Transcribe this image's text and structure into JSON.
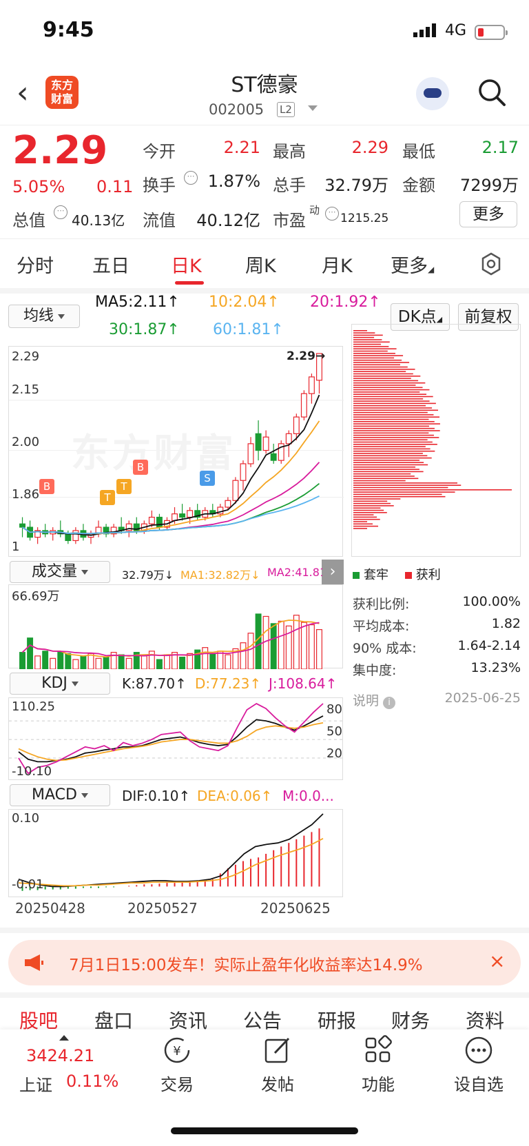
{
  "status_bar": {
    "time": "9:45",
    "network": "4G"
  },
  "header": {
    "name": "ST德豪",
    "code": "002005",
    "level_badge": "L2",
    "logo_line1": "东方",
    "logo_line2": "财富"
  },
  "quote": {
    "price": "2.29",
    "change_pct": "5.05%",
    "change": "0.11",
    "open_label": "今开",
    "open": "2.21",
    "high_label": "最高",
    "high": "2.29",
    "low_label": "最低",
    "low": "2.17",
    "turnover_label": "换手",
    "turnover": "1.87%",
    "volume_label": "总手",
    "volume": "32.79万",
    "amount_label": "金额",
    "amount": "7299万",
    "mktcap_label": "总值",
    "mktcap": "40.13亿",
    "float_label": "流值",
    "float_cap": "40.12亿",
    "pe_label": "市盈",
    "pe_sup": "动",
    "pe": "1215.25",
    "more": "更多"
  },
  "period_tabs": [
    "分时",
    "五日",
    "日K",
    "周K",
    "月K",
    "更多"
  ],
  "ma_bar": {
    "selector": "均线",
    "ma5": "MA5:2.11↑",
    "ma10": "10:2.04↑",
    "ma20": "20:1.92↑",
    "ma30": "30:1.87↑",
    "ma60": "60:1.81↑",
    "dk": "DK点",
    "adjust": "前复权"
  },
  "colors": {
    "up": "#e8262d",
    "down": "#1a9c33",
    "ma5": "#111111",
    "ma10": "#f5a623",
    "ma20": "#d81b9c",
    "ma30": "#1a9c33",
    "ma60": "#5ab4f0"
  },
  "kline": {
    "y_labels": [
      "2.29",
      "2.15",
      "2.00",
      "1.86",
      "1"
    ],
    "last_label": "2.29→",
    "markers": [
      "B",
      "T",
      "T",
      "B",
      "S"
    ],
    "watermark": "东方财富"
  },
  "volume_pane": {
    "selector": "成交量",
    "vol": "32.79万↓",
    "ma1": "MA1:32.82万↓",
    "ma2": "MA2:41.81...",
    "max": "66.69万"
  },
  "kdj_pane": {
    "selector": "KDJ",
    "k": "K:87.70↑",
    "d": "D:77.23↑",
    "j": "J:108.64↑",
    "max": "110.25",
    "min": "-10.10",
    "levels": [
      "80",
      "50",
      "20"
    ]
  },
  "macd_pane": {
    "selector": "MACD",
    "dif": "DIF:0.10↑",
    "dea": "DEA:0.06↑",
    "m": "M:0.0...",
    "max": "0.10",
    "min": "-0.01"
  },
  "dates": [
    "20250428",
    "20250527",
    "20250625"
  ],
  "chips": {
    "legend_trapped": "套牢",
    "legend_profit": "获利",
    "rows": [
      {
        "label": "获利比例:",
        "value": "100.00%"
      },
      {
        "label": "平均成本:",
        "value": "1.82"
      },
      {
        "label": "90% 成本:",
        "value": "1.64-2.14"
      },
      {
        "label": "集中度:",
        "value": "13.23%"
      }
    ],
    "note_label": "说明",
    "date": "2025-06-25"
  },
  "banner": {
    "text": "7月1日15:00发车！实际止盈年化收益率达14.9%",
    "close": "×"
  },
  "content_tabs": [
    "股吧",
    "盘口",
    "资讯",
    "公告",
    "研报",
    "财务",
    "资料"
  ],
  "bottom_nav": {
    "index_value": "3424.21",
    "index_name": "上证",
    "index_pct": "0.11%",
    "items": [
      "交易",
      "发帖",
      "功能",
      "设自选"
    ],
    "icons": [
      "yen-cycle-icon",
      "edit-icon",
      "grid-icon",
      "more-icon"
    ]
  },
  "chart_data": [
    {
      "type": "candlestick",
      "title": "",
      "ylim": [
        1.7,
        2.29
      ],
      "x_range": [
        "20250428",
        "20250625"
      ],
      "candles": [
        [
          1.78,
          1.8,
          1.74,
          1.77
        ],
        [
          1.77,
          1.79,
          1.73,
          1.74
        ],
        [
          1.74,
          1.77,
          1.72,
          1.76
        ],
        [
          1.76,
          1.78,
          1.74,
          1.75
        ],
        [
          1.75,
          1.77,
          1.73,
          1.76
        ],
        [
          1.76,
          1.79,
          1.74,
          1.75
        ],
        [
          1.75,
          1.76,
          1.72,
          1.73
        ],
        [
          1.73,
          1.77,
          1.72,
          1.76
        ],
        [
          1.76,
          1.78,
          1.73,
          1.74
        ],
        [
          1.74,
          1.76,
          1.72,
          1.75
        ],
        [
          1.75,
          1.79,
          1.74,
          1.77
        ],
        [
          1.77,
          1.78,
          1.74,
          1.75
        ],
        [
          1.75,
          1.78,
          1.74,
          1.77
        ],
        [
          1.77,
          1.8,
          1.75,
          1.76
        ],
        [
          1.76,
          1.79,
          1.74,
          1.78
        ],
        [
          1.78,
          1.8,
          1.75,
          1.76
        ],
        [
          1.76,
          1.79,
          1.75,
          1.78
        ],
        [
          1.78,
          1.82,
          1.77,
          1.8
        ],
        [
          1.8,
          1.81,
          1.76,
          1.77
        ],
        [
          1.77,
          1.8,
          1.76,
          1.79
        ],
        [
          1.79,
          1.83,
          1.78,
          1.81
        ],
        [
          1.81,
          1.84,
          1.79,
          1.8
        ],
        [
          1.8,
          1.83,
          1.78,
          1.82
        ],
        [
          1.82,
          1.84,
          1.79,
          1.8
        ],
        [
          1.8,
          1.83,
          1.79,
          1.82
        ],
        [
          1.82,
          1.84,
          1.8,
          1.81
        ],
        [
          1.81,
          1.84,
          1.8,
          1.83
        ],
        [
          1.83,
          1.86,
          1.82,
          1.85
        ],
        [
          1.85,
          1.92,
          1.84,
          1.91
        ],
        [
          1.91,
          1.97,
          1.88,
          1.96
        ],
        [
          1.96,
          2.04,
          1.95,
          2.02
        ],
        [
          2.05,
          2.09,
          1.97,
          2.0
        ],
        [
          2.0,
          2.06,
          1.99,
          2.04
        ],
        [
          1.99,
          2.02,
          1.96,
          1.97
        ],
        [
          1.97,
          2.03,
          1.96,
          2.02
        ],
        [
          2.02,
          2.06,
          1.98,
          2.05
        ],
        [
          2.05,
          2.11,
          2.03,
          2.1
        ],
        [
          2.1,
          2.18,
          2.09,
          2.17
        ],
        [
          2.17,
          2.23,
          2.14,
          2.22
        ],
        [
          2.21,
          2.29,
          2.17,
          2.29
        ]
      ]
    },
    {
      "type": "bar",
      "title": "",
      "ylim": [
        0,
        66.69
      ],
      "values": [
        14,
        26,
        11,
        15,
        9,
        14,
        13,
        8,
        11,
        13,
        9,
        10,
        14,
        12,
        9,
        14,
        11,
        15,
        8,
        12,
        14,
        10,
        13,
        16,
        18,
        13,
        15,
        12,
        17,
        22,
        30,
        46,
        44,
        38,
        40,
        36,
        45,
        39,
        37,
        33
      ]
    },
    {
      "type": "line",
      "title": "",
      "ylim": [
        -10.1,
        110.25
      ],
      "series": [
        {
          "name": "K",
          "values": [
            30,
            18,
            14,
            14,
            16,
            18,
            22,
            28,
            30,
            33,
            35,
            38,
            38,
            40,
            45,
            50,
            52,
            54,
            50,
            45,
            42,
            40,
            42,
            55,
            70,
            82,
            80,
            76,
            70,
            65,
            72,
            80,
            88
          ]
        },
        {
          "name": "D",
          "values": [
            35,
            28,
            22,
            18,
            16,
            17,
            20,
            23,
            26,
            29,
            32,
            35,
            37,
            39,
            42,
            46,
            48,
            50,
            50,
            48,
            46,
            44,
            44,
            48,
            55,
            65,
            70,
            72,
            70,
            68,
            70,
            74,
            77
          ]
        },
        {
          "name": "J",
          "values": [
            20,
            -5,
            5,
            8,
            14,
            22,
            30,
            38,
            35,
            40,
            32,
            45,
            40,
            44,
            50,
            58,
            60,
            62,
            48,
            38,
            35,
            32,
            40,
            70,
            98,
            108,
            100,
            85,
            72,
            62,
            78,
            94,
            108
          ]
        }
      ]
    },
    {
      "type": "bar",
      "title": "",
      "ylim": [
        -0.01,
        0.1
      ],
      "values": [
        -0.006,
        -0.005,
        -0.005,
        -0.004,
        -0.004,
        -0.004,
        -0.003,
        -0.003,
        -0.002,
        -0.002,
        -0.002,
        -0.001,
        -0.001,
        0.0,
        0.001,
        0.002,
        0.003,
        0.003,
        0.004,
        0.005,
        0.005,
        0.006,
        0.006,
        0.007,
        0.008,
        0.01,
        0.018,
        0.025,
        0.03,
        0.035,
        0.038,
        0.04,
        0.045,
        0.05,
        0.055,
        0.06,
        0.065,
        0.07,
        0.075,
        0.08
      ],
      "series": [
        {
          "name": "DIF",
          "values": [
            0.01,
            0.005,
            0.002,
            0.0,
            0.0,
            0.001,
            0.002,
            0.003,
            0.004,
            0.005,
            0.006,
            0.007,
            0.008,
            0.008,
            0.007,
            0.007,
            0.008,
            0.01,
            0.015,
            0.03,
            0.045,
            0.055,
            0.058,
            0.06,
            0.065,
            0.075,
            0.085,
            0.1
          ]
        },
        {
          "name": "DEA",
          "values": [
            0.005,
            0.004,
            0.003,
            0.002,
            0.001,
            0.001,
            0.002,
            0.002,
            0.003,
            0.004,
            0.005,
            0.005,
            0.006,
            0.006,
            0.006,
            0.006,
            0.007,
            0.008,
            0.01,
            0.015,
            0.022,
            0.03,
            0.036,
            0.042,
            0.047,
            0.052,
            0.058,
            0.066
          ]
        }
      ]
    }
  ]
}
